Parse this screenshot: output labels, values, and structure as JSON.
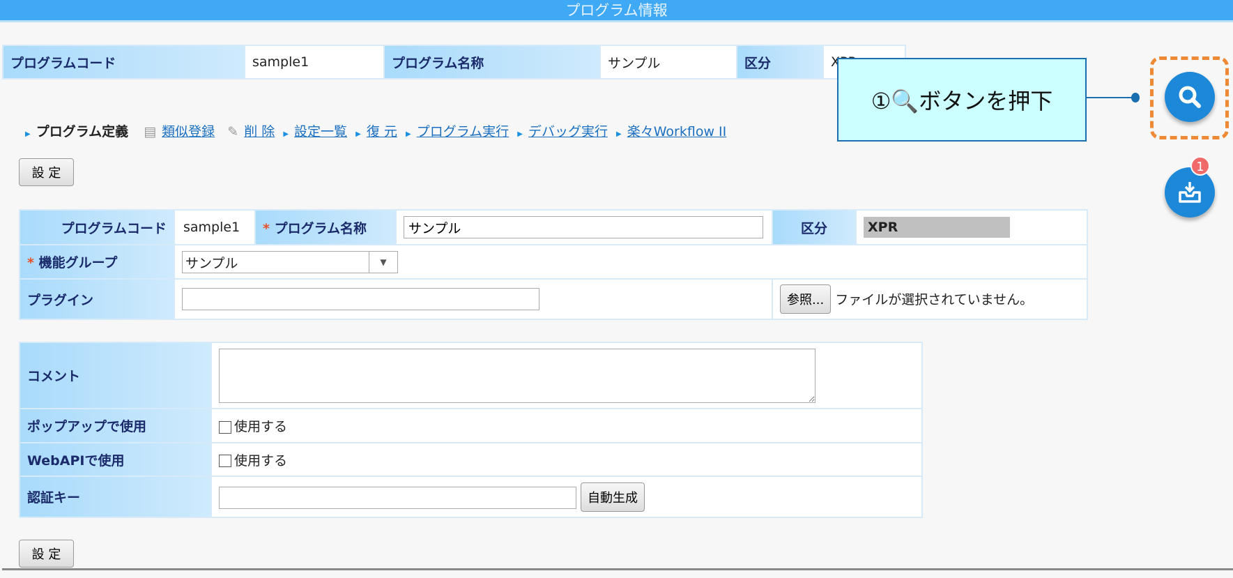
{
  "header": {
    "title": "プログラム情報"
  },
  "summary": {
    "code_label": "プログラムコード",
    "code_value": "sample1",
    "name_label": "プログラム名称",
    "name_value": "サンプル",
    "kubun_label": "区分",
    "kubun_value": "XPR"
  },
  "links": {
    "current": "プログラム定義",
    "items": [
      "類似登録",
      "削 除",
      "設定一覧",
      "復 元",
      "プログラム実行",
      "デバッグ実行",
      "楽々Workflow II"
    ]
  },
  "buttons": {
    "settei_top": "設 定",
    "settei_bottom": "設 定",
    "browse": "参照...",
    "autogen": "自動生成"
  },
  "form": {
    "code_label": "プログラムコード",
    "code_value": "sample1",
    "required_mark": "*",
    "name_label": "プログラム名称",
    "name_value": "サンプル",
    "kubun_label": "区分",
    "kubun_value": "XPR",
    "group_label": "機能グループ",
    "group_value": "サンプル",
    "plugin_label": "プラグイン",
    "plugin_value": "",
    "file_status": "ファイルが選択されていません。"
  },
  "form2": {
    "comment_label": "コメント",
    "comment_value": "",
    "popup_label": "ポップアップで使用",
    "popup_check": "使用する",
    "popup_checked": false,
    "webapi_label": "WebAPIで使用",
    "webapi_check": "使用する",
    "webapi_checked": false,
    "authkey_label": "認証キー",
    "authkey_value": ""
  },
  "callout": {
    "text": "①🔍ボタンを押下"
  },
  "inbox_badge": "1",
  "colors": {
    "header": "#3fa9f5",
    "accent": "#1e88d8",
    "highlight": "#ee8a35"
  }
}
